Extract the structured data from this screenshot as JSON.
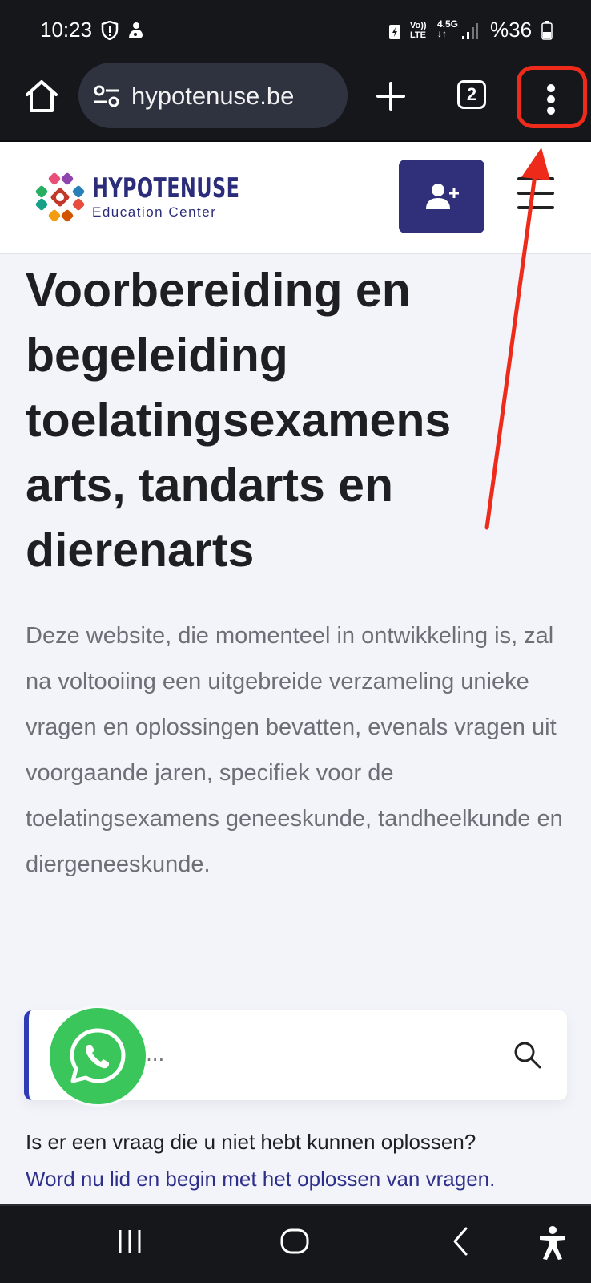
{
  "status": {
    "time": "10:23",
    "network_volte": "Vo)) LTE",
    "network_gen": "4.5G",
    "battery": "%36"
  },
  "browser": {
    "url": "hypotenuse.be",
    "tab_count": "2"
  },
  "site": {
    "logo_name": "HYPOTENUSE",
    "logo_sub": "Education Center",
    "accent_color": "#30307a"
  },
  "main": {
    "title": "Voorbereiding en begeleiding toelatingsexamens arts, tandarts en dierenarts",
    "intro": "Deze website, die momenteel in ontwikkeling is, zal na voltooiing een uitgebreide verzameling unieke vragen en oplossingen bevatten, evenals vragen uit voorgaande jaren, specifiek voor de toelatingsexamens geneeskunde, tandheelkunde en diergeneeskunde.",
    "search_placeholder": "...",
    "question": "Is er een vraag die u niet hebt kunnen oplossen?",
    "join_link": "Word nu lid en begin met het oplossen van vragen."
  },
  "icons": {
    "home": "home-icon",
    "site_settings": "tune-icon",
    "new_tab": "plus-icon",
    "menu": "kebab-menu-icon",
    "register": "add-user-icon",
    "hamburger": "hamburger-icon",
    "search": "search-icon",
    "whatsapp": "whatsapp-icon"
  },
  "annotation": {
    "color": "#ee2b1b"
  }
}
